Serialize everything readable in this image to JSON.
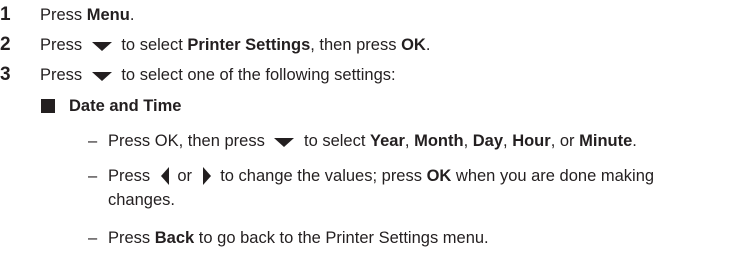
{
  "steps": [
    {
      "number": "1",
      "parts": {
        "a": "Press ",
        "b": "Menu",
        "c": "."
      }
    },
    {
      "number": "2",
      "parts": {
        "a": "Press ",
        "b": " to select ",
        "c": "Printer Settings",
        "d": ", then press ",
        "e": "OK",
        "f": "."
      }
    },
    {
      "number": "3",
      "parts": {
        "a": "Press ",
        "b": " to select one of the following settings:"
      }
    }
  ],
  "subsection": {
    "heading": "Date and Time",
    "items": [
      {
        "dash": "–",
        "parts": {
          "a": "Press OK, then press ",
          "b": " to select ",
          "c": "Year",
          "d": ", ",
          "e": "Month",
          "f": ", ",
          "g": "Day",
          "h": ", ",
          "i": "Hour",
          "j": ", or ",
          "k": "Minute",
          "l": "."
        }
      },
      {
        "dash": "–",
        "parts": {
          "a": "Press ",
          "b": " or ",
          "c": " to change the values; press ",
          "d": "OK",
          "e": " when you are done making",
          "f": "changes."
        }
      },
      {
        "dash": "–",
        "parts": {
          "a": "Press ",
          "b": "Back",
          "c": " to go back to the Printer Settings menu."
        }
      }
    ]
  },
  "icons": {
    "down_arrow": "down-triangle-icon",
    "left_arrow": "left-triangle-icon",
    "right_arrow": "right-triangle-icon",
    "bullet": "square-bullet-icon"
  }
}
